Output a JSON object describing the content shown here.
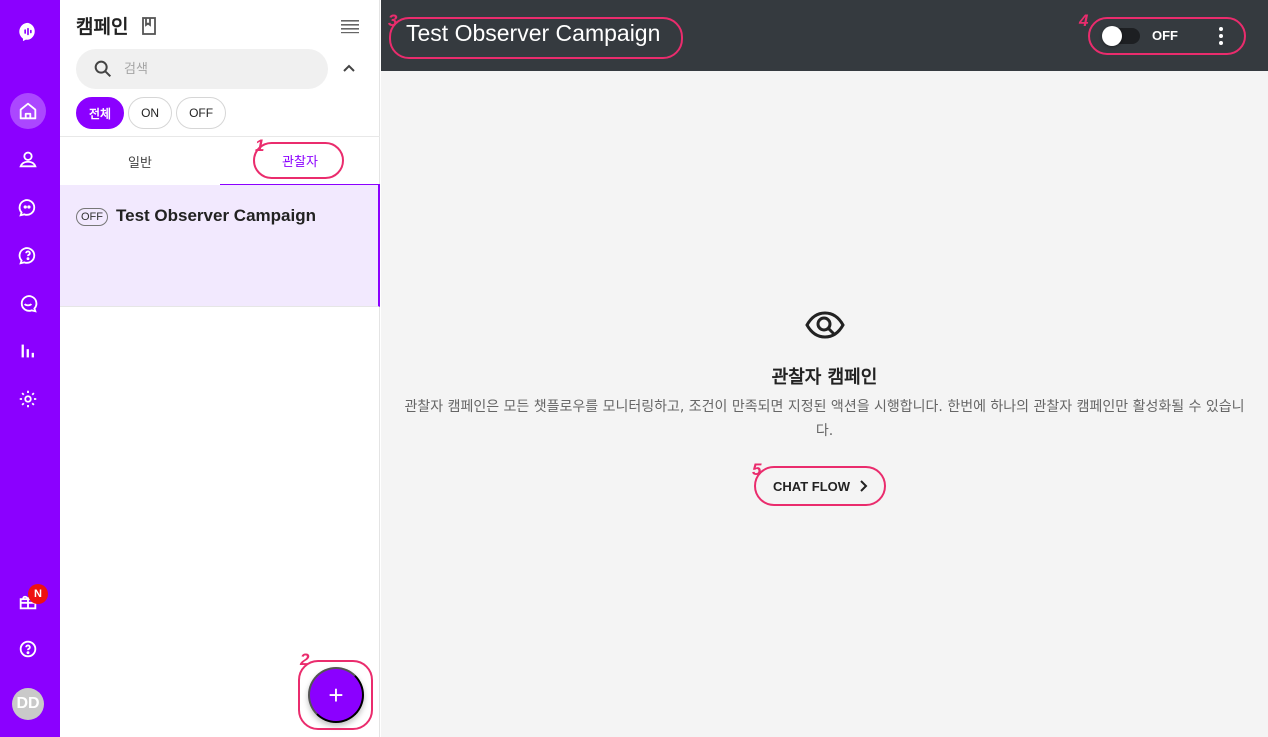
{
  "sidebar_rail": {
    "items": [
      {
        "icon": "logo-icon"
      },
      {
        "icon": "home-icon",
        "active": true
      },
      {
        "icon": "user-icon"
      },
      {
        "icon": "chat-icon"
      },
      {
        "icon": "help-chat-icon"
      },
      {
        "icon": "search-chat-icon"
      },
      {
        "icon": "bar-chart-icon"
      },
      {
        "icon": "gear-icon"
      },
      {
        "icon": "gift-icon"
      },
      {
        "icon": "help-circle-icon"
      }
    ],
    "new_badge": "N",
    "avatar_initials": "DD",
    "accent_color": "#8b00ff"
  },
  "panel": {
    "title": "캠페인",
    "search_placeholder": "검색",
    "filters": [
      "전체",
      "ON",
      "OFF"
    ],
    "selected_filter": "전체",
    "tabs": [
      "일반",
      "관찰자"
    ],
    "active_tab": "관찰자",
    "campaigns": [
      {
        "status": "OFF",
        "name": "Test Observer Campaign"
      }
    ],
    "add_button_label": "+"
  },
  "header": {
    "title": "Test Observer Campaign",
    "toggle_label": "OFF",
    "toggle_on": false
  },
  "main": {
    "title": "관찰자 캠페인",
    "description": "관찰자 캠페인은 모든 챗플로우를 모니터링하고, 조건이 만족되면 지정된 액션을 시행합니다. 한번에 하나의 관찰자 캠페인만 활성화될 수 있습니다.",
    "cta_label": "CHAT FLOW"
  },
  "annotations": [
    "1",
    "2",
    "3",
    "4",
    "5"
  ],
  "annotation_color": "#ea2c6d"
}
